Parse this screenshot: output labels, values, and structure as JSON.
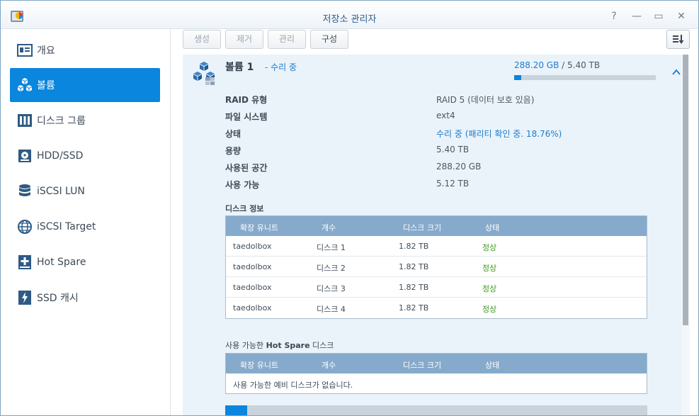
{
  "window": {
    "title": "저장소 관리자",
    "controls": {
      "help": "?",
      "minimize": "—",
      "maximize": "▭",
      "close": "✕"
    }
  },
  "sidebar": {
    "items": [
      {
        "label": "개요",
        "icon": "overview-icon",
        "active": false
      },
      {
        "label": "볼륨",
        "icon": "volume-icon",
        "active": true
      },
      {
        "label": "디스크 그룹",
        "icon": "disk-group-icon",
        "active": false
      },
      {
        "label": "HDD/SSD",
        "icon": "hdd-icon",
        "active": false
      },
      {
        "label": "iSCSI LUN",
        "icon": "iscsi-lun-icon",
        "active": false
      },
      {
        "label": "iSCSI Target",
        "icon": "iscsi-target-icon",
        "active": false
      },
      {
        "label": "Hot Spare",
        "icon": "hot-spare-icon",
        "active": false
      },
      {
        "label": "SSD 캐시",
        "icon": "ssd-cache-icon",
        "active": false
      }
    ]
  },
  "toolbar": {
    "create": "생성",
    "remove": "제거",
    "manage": "관리",
    "configure": "구성"
  },
  "volume": {
    "name": "볼륨 1",
    "status": "- 수리 중",
    "used": "288.20 GB",
    "separator": " / ",
    "total": "5.40 TB",
    "usage_fraction": 0.052,
    "properties": [
      {
        "label": "RAID 유형",
        "value": "RAID 5 (데이터 보호 있음)",
        "link": false
      },
      {
        "label": "파일 시스템",
        "value": "ext4",
        "link": false
      },
      {
        "label": "상태",
        "value": "수리 중 (패리티 확인 중. 18.76%)",
        "link": true
      },
      {
        "label": "용량",
        "value": "5.40 TB",
        "link": false
      },
      {
        "label": "사용된 공간",
        "value": "288.20 GB",
        "link": false
      },
      {
        "label": "사용 가능",
        "value": "5.12 TB",
        "link": false
      }
    ]
  },
  "disk_info": {
    "title": "디스크 정보",
    "columns": [
      "확장 유니트",
      "개수",
      "디스크 크기",
      "상태"
    ],
    "rows": [
      [
        "taedolbox",
        "디스크 1",
        "1.82 TB",
        "정상"
      ],
      [
        "taedolbox",
        "디스크 2",
        "1.82 TB",
        "정상"
      ],
      [
        "taedolbox",
        "디스크 3",
        "1.82 TB",
        "정상"
      ],
      [
        "taedolbox",
        "디스크 4",
        "1.82 TB",
        "정상"
      ]
    ]
  },
  "hot_spare": {
    "title_prefix": "사용 가능한 ",
    "title_bold": "Hot Spare",
    "title_suffix": " 디스크",
    "columns": [
      "확장 유니트",
      "개수",
      "디스크 크기",
      "상태"
    ],
    "empty_message": "사용 가능한 예비 디스크가 없습니다."
  },
  "colors": {
    "accent": "#0a86de",
    "status_ok": "#3d9b1e",
    "link": "#1d7ccd",
    "grid_header": "#86aacb",
    "panel_bg": "#eaf3fa"
  }
}
